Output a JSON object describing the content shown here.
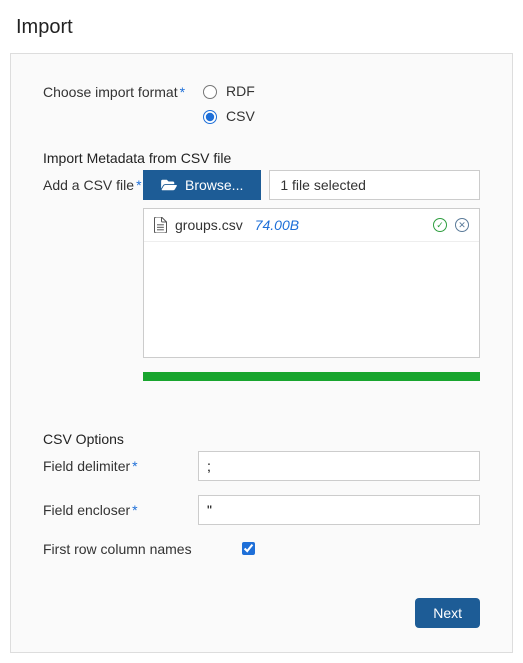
{
  "title": "Import",
  "format": {
    "label": "Choose import format",
    "options": {
      "rdf": "RDF",
      "csv": "CSV"
    },
    "selected": "csv"
  },
  "metadata": {
    "heading": "Import Metadata from CSV file",
    "add_label": "Add a CSV file",
    "browse_label": "Browse...",
    "status_text": "1 file selected",
    "files": [
      {
        "name": "groups.csv",
        "size": "74.00B"
      }
    ]
  },
  "csv_options": {
    "heading": "CSV Options",
    "delimiter_label": "Field delimiter",
    "delimiter_value": ";",
    "encloser_label": "Field encloser",
    "encloser_value": "\"",
    "first_row_label": "First row column names",
    "first_row_checked": true
  },
  "actions": {
    "next_label": "Next"
  }
}
